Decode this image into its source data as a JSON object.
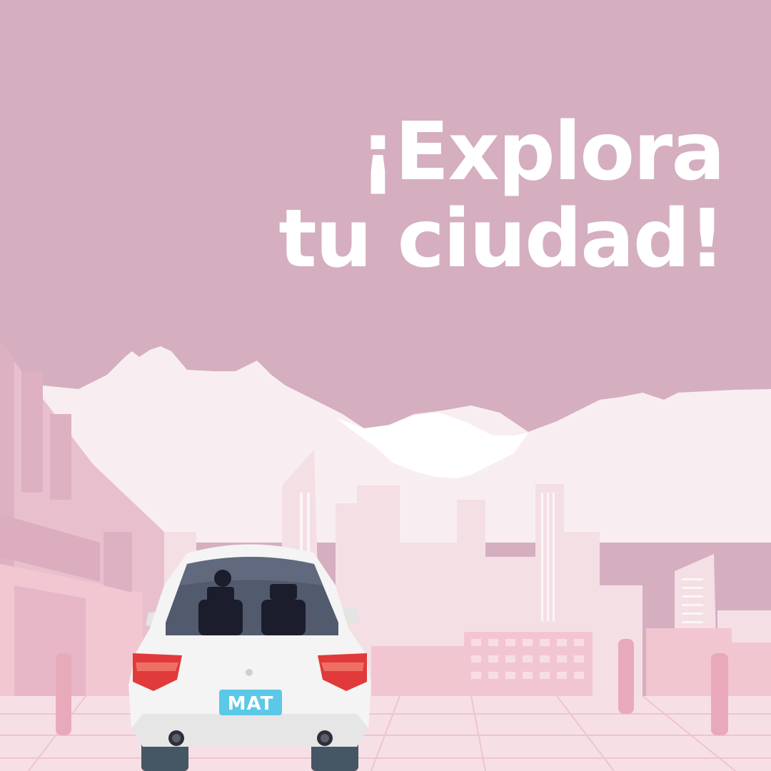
{
  "headline": {
    "line1": "¡Explora",
    "line2": "tu ciudad!"
  },
  "car": {
    "plate_text": "MAT"
  },
  "colors": {
    "sky": "#d5aec0",
    "headline_text": "#ffffff",
    "plate": "#5bc8e8",
    "car_body": "#f2f2f2",
    "tail_light": "#e03a3a"
  }
}
